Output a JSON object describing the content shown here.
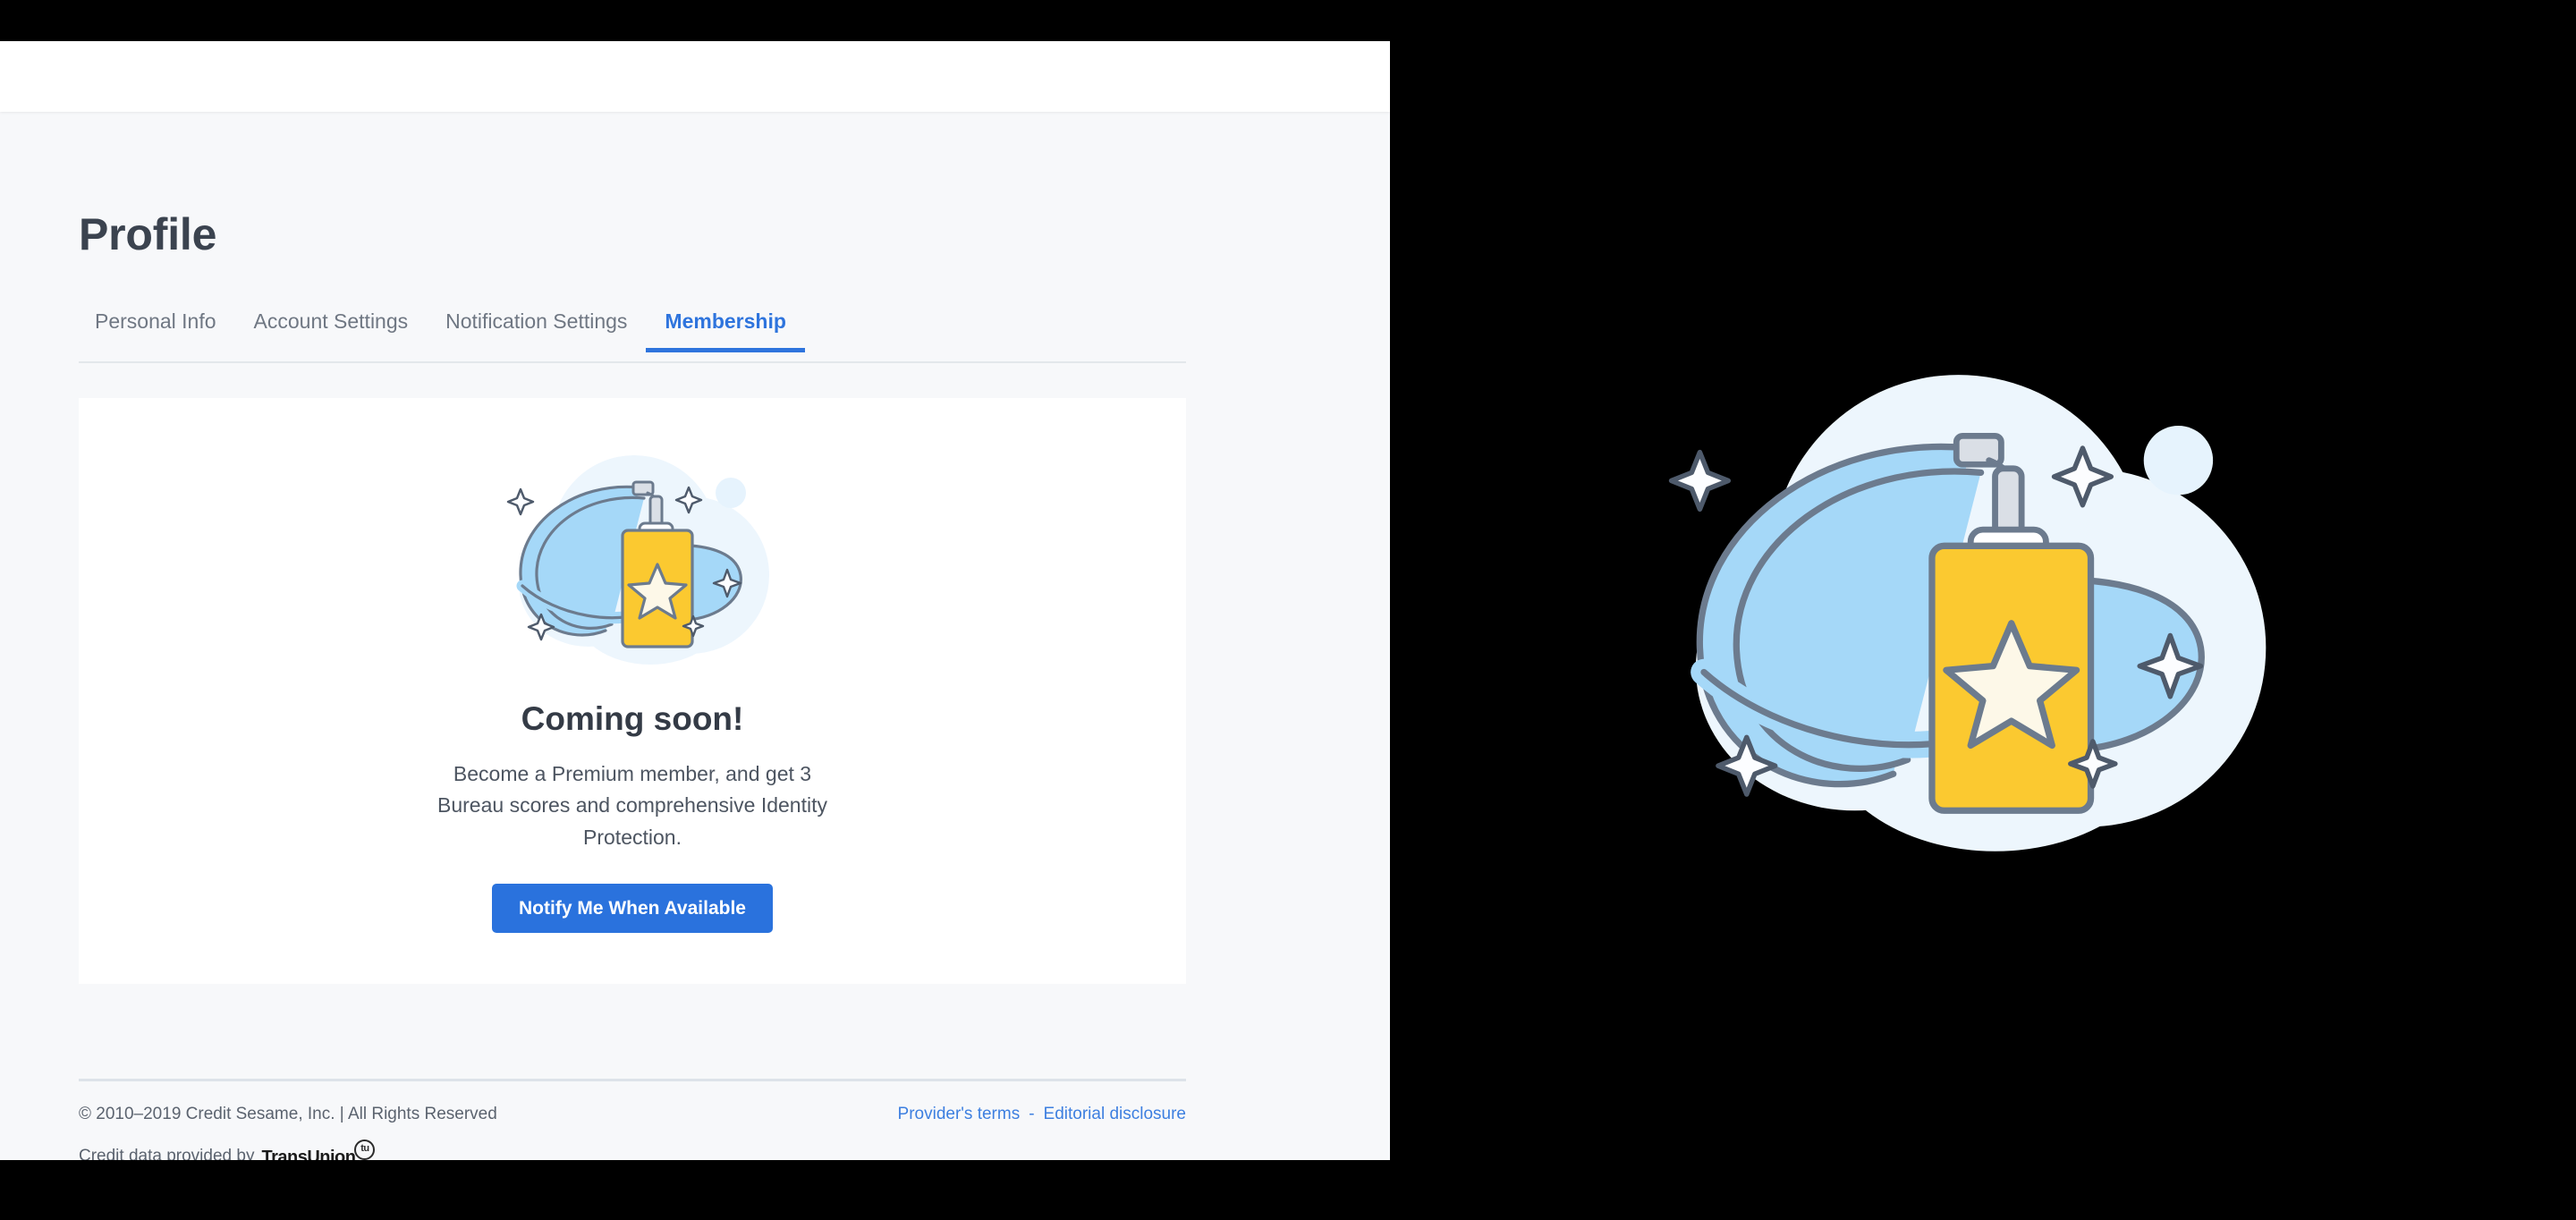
{
  "window": {
    "backdrop_color": "#000000",
    "page_background": "#f7f8fa",
    "header_background": "#ffffff"
  },
  "header": {
    "title": "Profile"
  },
  "tabs": [
    {
      "label": "Personal Info",
      "active": false
    },
    {
      "label": "Account Settings",
      "active": false
    },
    {
      "label": "Notification Settings",
      "active": false
    },
    {
      "label": "Membership",
      "active": true
    }
  ],
  "card": {
    "illustration_name": "premium-membership-badge-illustration",
    "heading": "Coming soon!",
    "body": "Become a Premium member, and get 3 Bureau scores and comprehensive Identity Protection.",
    "cta_label": "Notify Me When Available"
  },
  "footer": {
    "copyright": "© 2010–2019 Credit Sesame, Inc. | All Rights Reserved",
    "credit_data_prefix": "Credit data provided by",
    "credit_bureau": "TransUnion",
    "credit_bureau_mark": "tu",
    "credit_bureau_reg": ".",
    "links": [
      {
        "label": "Provider's terms"
      },
      {
        "label": "Editorial disclosure"
      }
    ],
    "link_separator": "-"
  },
  "colors": {
    "accent_blue": "#2a72dd",
    "tab_active_blue": "#2e74dd",
    "link_blue": "#3d7fe0",
    "heading_dark": "#343b46",
    "muted_text": "#6f7783",
    "badge_yellow": "#fbc930",
    "star_cream": "#fdf8e8",
    "lanyard_blue": "#a5d8f8",
    "outline_gray": "#6c7b8e",
    "cloud_pale_blue": "#edf6fd"
  }
}
